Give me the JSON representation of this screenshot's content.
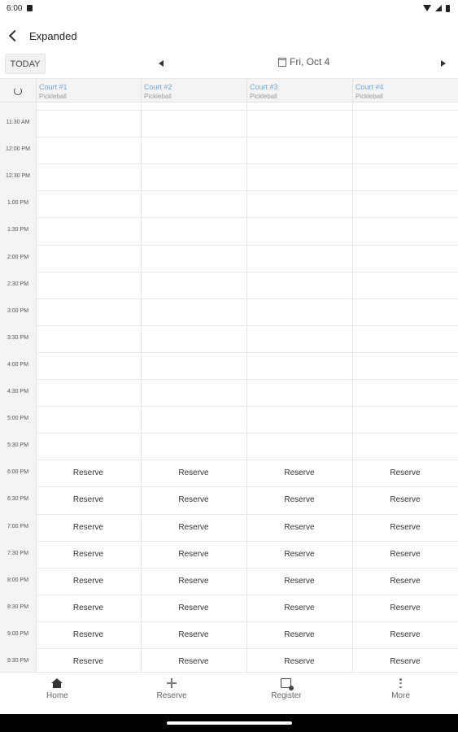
{
  "status_bar": {
    "time": "6:00"
  },
  "app_bar": {
    "title": "Expanded"
  },
  "date_nav": {
    "today_label": "TODAY",
    "date": "Fri, Oct 4"
  },
  "courts": [
    {
      "name": "Court #1",
      "sport": "Pickleball"
    },
    {
      "name": "Court #2",
      "sport": "Pickleball"
    },
    {
      "name": "Court #3",
      "sport": "Pickleball"
    },
    {
      "name": "Court #4",
      "sport": "Pickleball"
    }
  ],
  "time_slots": [
    "11:30 AM",
    "12:00 PM",
    "12:30 PM",
    "1:00 PM",
    "1:30 PM",
    "2:00 PM",
    "2:30 PM",
    "3:00 PM",
    "3:30 PM",
    "4:00 PM",
    "4:30 PM",
    "5:00 PM",
    "5:30 PM",
    "6:00 PM",
    "6:30 PM",
    "7:00 PM",
    "7:30 PM",
    "8:00 PM",
    "8:30 PM",
    "9:00 PM",
    "9:30 PM"
  ],
  "reserve_label": "Reserve",
  "reservable_slots": [
    "6:00 PM",
    "6:30 PM",
    "7:00 PM",
    "7:30 PM",
    "8:00 PM",
    "8:30 PM",
    "9:00 PM",
    "9:30 PM"
  ],
  "bottom_nav": [
    {
      "label": "Home",
      "icon": "home-icon"
    },
    {
      "label": "Reserve",
      "icon": "plus-icon"
    },
    {
      "label": "Register",
      "icon": "calendar-icon"
    },
    {
      "label": "More",
      "icon": "more-vertical-icon"
    }
  ],
  "colors": {
    "court_name": "#6fa7d8",
    "header_bg": "#f4f4f4"
  }
}
